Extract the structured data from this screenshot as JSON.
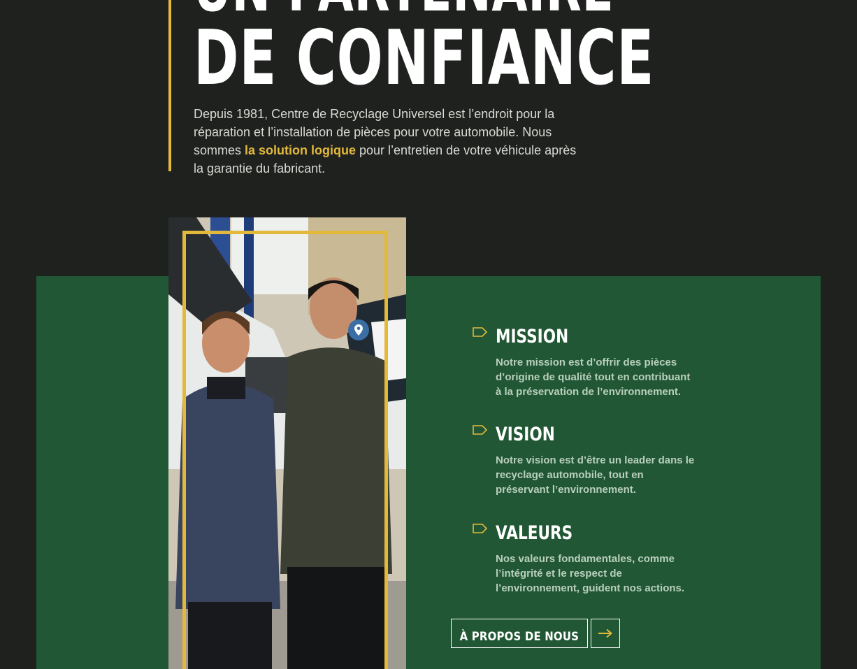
{
  "hero": {
    "title_line1": "UN PARTENAIRE",
    "title_line2": "DE CONFIANCE",
    "intro_before": "Depuis 1981, Centre de Recyclage Universel est l’endroit pour la réparation et l’installation de pièces pour votre automobile. Nous sommes ",
    "intro_highlight": "la solution logique",
    "intro_after": " pour l’entretien de votre véhicule après la garantie du fabricant."
  },
  "photo": {
    "alt": "Deux employés souriants devant des véhicules dans un garage"
  },
  "cards": [
    {
      "title": "MISSION",
      "text": "Notre mission est d’offrir des pièces d’origine de qualité tout en contribuant à la préservation de l’environnement."
    },
    {
      "title": "VISION",
      "text": "Notre vision est d’être un leader dans le recyclage automobile, tout en préservant l’environnement."
    },
    {
      "title": "VALEURS",
      "text": "Nos valeurs fondamentales, comme l’intégrité et le respect de l’environnement, guident nos actions."
    }
  ],
  "buttons": {
    "about_label": "À PROPOS DE NOUS"
  },
  "icons": {
    "tag": "tag-icon",
    "arrow": "arrow-right-icon",
    "pin": "location-pin-icon"
  },
  "colors": {
    "background": "#1f211f",
    "green": "#215734",
    "accent": "#e2b93b",
    "text_light": "#d9d9d4"
  }
}
